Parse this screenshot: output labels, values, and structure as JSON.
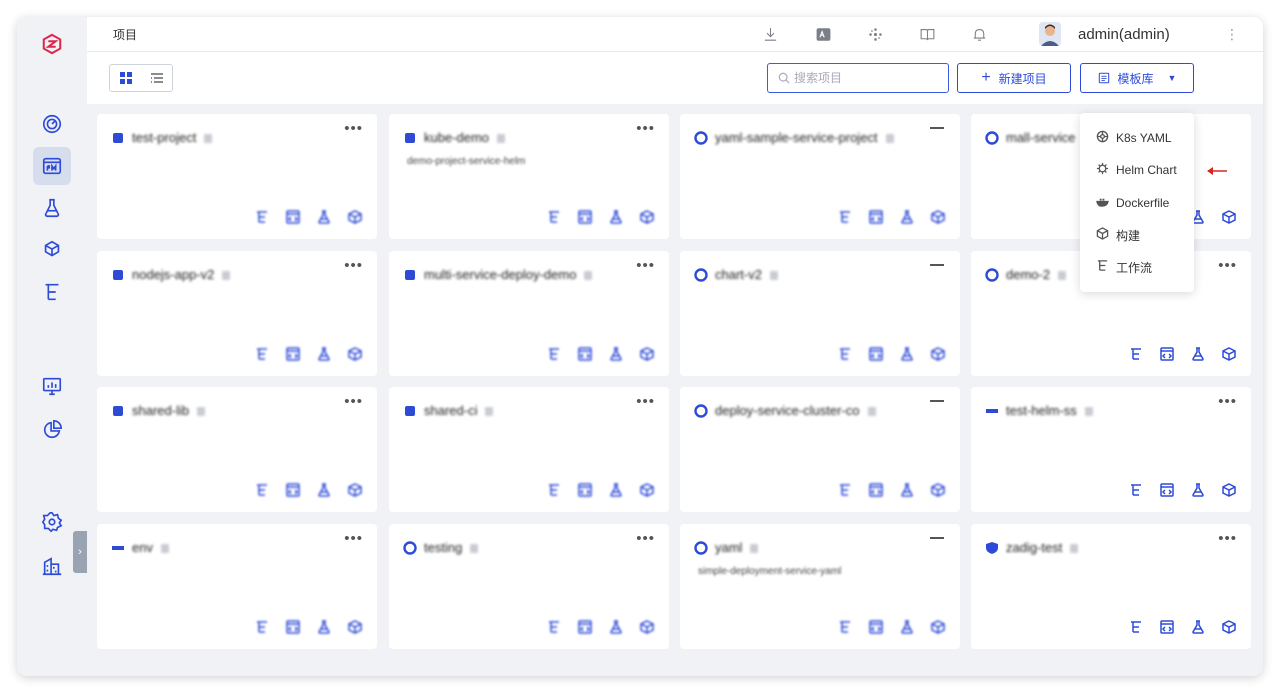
{
  "header": {
    "breadcrumb": "项目",
    "username": "admin(admin)"
  },
  "toolbar": {
    "search_placeholder": "搜索项目",
    "new_project_label": "新建项目",
    "template_label": "模板库"
  },
  "template_menu": {
    "items": [
      {
        "label": "K8s YAML",
        "icon": "k8s-icon"
      },
      {
        "label": "Helm Chart",
        "icon": "helm-icon"
      },
      {
        "label": "Dockerfile",
        "icon": "docker-icon"
      },
      {
        "label": "构建",
        "icon": "build-icon"
      },
      {
        "label": "工作流",
        "icon": "workflow-icon"
      }
    ]
  },
  "projects": [
    {
      "title": "test-project",
      "subtitle": ""
    },
    {
      "title": "kube-demo",
      "subtitle": "demo-project-service-helm"
    },
    {
      "title": "yaml-sample-service-project",
      "subtitle": ""
    },
    {
      "title": "mall-service",
      "subtitle": ""
    },
    {
      "title": "nodejs-app-v2",
      "subtitle": ""
    },
    {
      "title": "multi-service-deploy-demo",
      "subtitle": ""
    },
    {
      "title": "chart-v2",
      "subtitle": ""
    },
    {
      "title": "demo-2",
      "subtitle": ""
    },
    {
      "title": "shared-lib",
      "subtitle": ""
    },
    {
      "title": "shared-ci",
      "subtitle": ""
    },
    {
      "title": "deploy-service-cluster-co",
      "subtitle": ""
    },
    {
      "title": "test-helm-ss",
      "subtitle": ""
    },
    {
      "title": "env",
      "subtitle": ""
    },
    {
      "title": "testing",
      "subtitle": ""
    },
    {
      "title": "yaml",
      "subtitle": "simple-deployment-service-yaml"
    },
    {
      "title": "zadig-test",
      "subtitle": ""
    }
  ]
}
